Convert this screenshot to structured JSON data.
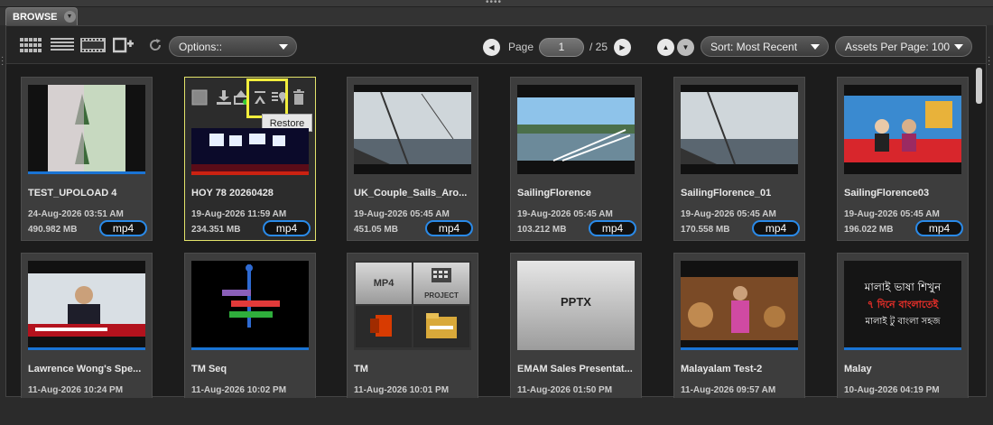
{
  "tab": {
    "label": "BROWSE"
  },
  "toolbar": {
    "options_label": "Options::",
    "page_label": "Page",
    "page_current": "1",
    "page_total": "/ 25",
    "sort_label": "Sort: Most Recent",
    "per_page_label": "Assets Per Page: 100"
  },
  "hover": {
    "tooltip": "Restore"
  },
  "assets": [
    {
      "title": "TEST_UPOLOAD 4",
      "date": "24-Aug-2026 03:51 AM",
      "size": "490.982 MB",
      "format": "mp4"
    },
    {
      "title": "HOY 78 20260428",
      "date": "19-Aug-2026 11:59 AM",
      "size": "234.351 MB",
      "format": "mp4"
    },
    {
      "title": "UK_Couple_Sails_Aro...",
      "date": "19-Aug-2026 05:45 AM",
      "size": "451.05 MB",
      "format": "mp4"
    },
    {
      "title": "SailingFlorence",
      "date": "19-Aug-2026 05:45 AM",
      "size": "103.212 MB",
      "format": "mp4"
    },
    {
      "title": "SailingFlorence_01",
      "date": "19-Aug-2026 05:45 AM",
      "size": "170.558 MB",
      "format": "mp4"
    },
    {
      "title": "SailingFlorence03",
      "date": "19-Aug-2026 05:45 AM",
      "size": "196.022 MB",
      "format": "mp4"
    },
    {
      "title": "Lawrence Wong's Spe...",
      "date": "11-Aug-2026 10:24 PM"
    },
    {
      "title": "TM Seq",
      "date": "11-Aug-2026 10:02 PM"
    },
    {
      "title": "TM",
      "date": "11-Aug-2026 10:01 PM",
      "thumb_labels": [
        "MP4",
        "PROJECT"
      ]
    },
    {
      "title": "EMAM Sales Presentat...",
      "date": "11-Aug-2026 01:50 PM",
      "thumb_label": "PPTX"
    },
    {
      "title": "Malayalam Test-2",
      "date": "11-Aug-2026 09:57 AM"
    },
    {
      "title": "Malay",
      "date": "10-Aug-2026 04:19 PM",
      "thumb_lines": [
        "মালাই ভাষা শিখুন",
        "৭ দিনে বাংলাতেই",
        "মালাই টু বাংলা সহজ"
      ]
    }
  ],
  "colors": {
    "accent_blue": "#1a74d4",
    "selection": "#e3e36a",
    "highlight_box": "#f2ee3c"
  }
}
